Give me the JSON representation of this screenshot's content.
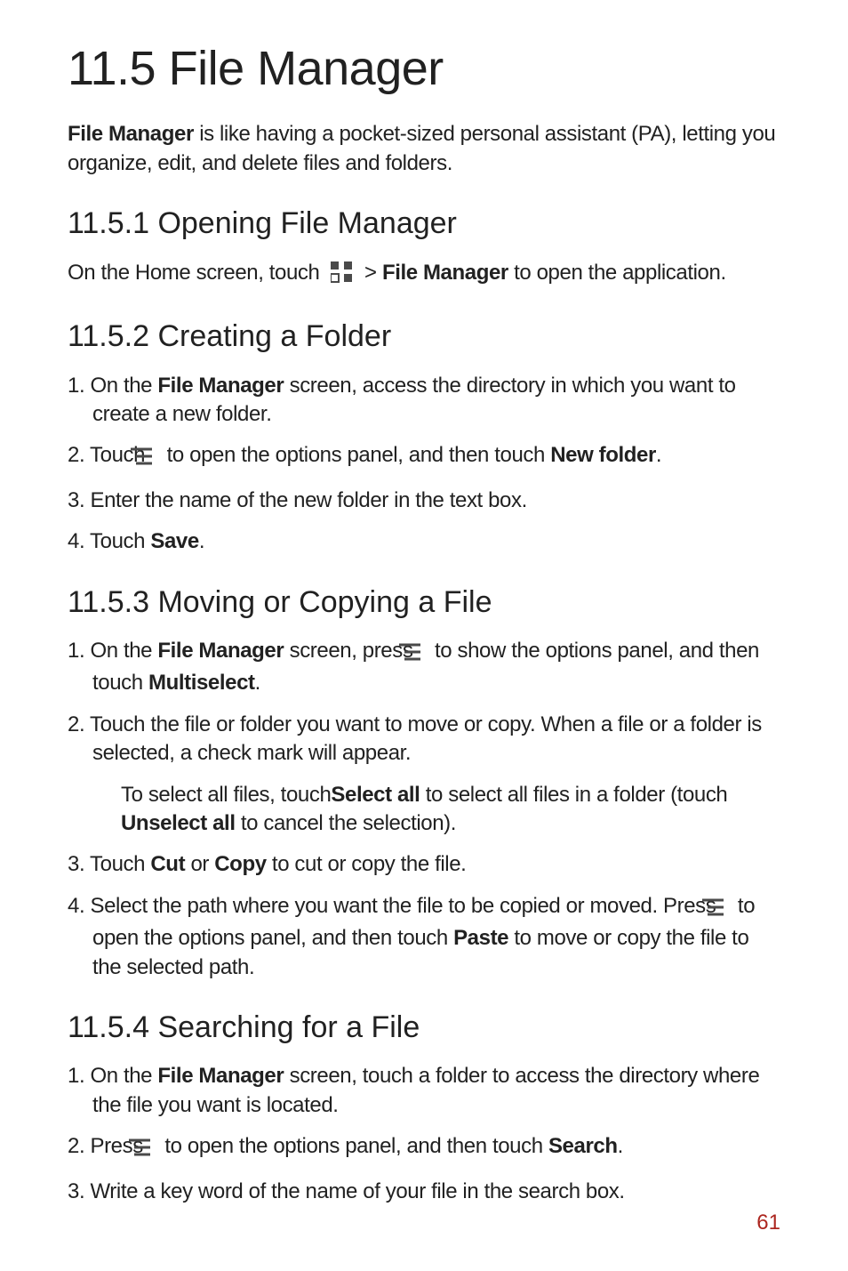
{
  "page_number": "61",
  "title": "11.5  File Manager",
  "intro": {
    "pre_bold": "File Manager",
    "post": " is like having a pocket-sized personal assistant (PA), letting you organize, edit, and delete files and folders."
  },
  "sec1": {
    "heading": "11.5.1   Opening File Manager",
    "p_a": "On the Home screen, touch ",
    "p_b": "  > ",
    "p_c": "File Manager",
    "p_d": " to open the application."
  },
  "sec2": {
    "heading": "11.5.2   Creating a Folder",
    "i1_a": "1. On the ",
    "i1_b": "File Manager",
    "i1_c": " screen, access the directory in which you want to create a new folder.",
    "i2_a": "2. Touch ",
    "i2_b": " to open the options panel, and then touch ",
    "i2_c": "New folder",
    "i2_d": ".",
    "i3": "3.  Enter the name of the new folder in the text box.",
    "i4_a": "4.  Touch ",
    "i4_b": "Save",
    "i4_c": "."
  },
  "sec3": {
    "heading": "11.5.3   Moving or Copying a File",
    "i1_a": "1. On the ",
    "i1_b": "File Manager",
    "i1_c": " screen, press ",
    "i1_d": " to show the options panel, and then touch ",
    "i1_e": "Multiselect",
    "i1_f": ".",
    "i2": "2.  Touch the file or folder you want to move or copy. When a file or a folder is selected, a check mark will appear.",
    "i2_note_a": "To select all files, touch",
    "i2_note_b": "Select all",
    "i2_note_c": " to select all files in a folder (touch ",
    "i2_note_d": "Unselect all",
    "i2_note_e": " to cancel the selection).",
    "i3_a": "3. Touch ",
    "i3_b": "Cut",
    "i3_c": " or ",
    "i3_d": "Copy",
    "i3_e": " to cut or copy the file.",
    "i4_a": "4. Select the path where you want the file to be copied or moved. Press ",
    "i4_b": " to open the options panel, and then touch ",
    "i4_c": "Paste",
    "i4_d": " to move or copy the file to the selected path."
  },
  "sec4": {
    "heading": "11.5.4   Searching for a File",
    "i1_a": "1. On the ",
    "i1_b": "File Manager",
    "i1_c": " screen, touch a folder to access the directory where the file you want is located.",
    "i2_a": "2. Press ",
    "i2_b": " to open the options panel, and then touch ",
    "i2_c": "Search",
    "i2_d": ".",
    "i3": "3.  Write a key word of the name of your file in the search box."
  }
}
